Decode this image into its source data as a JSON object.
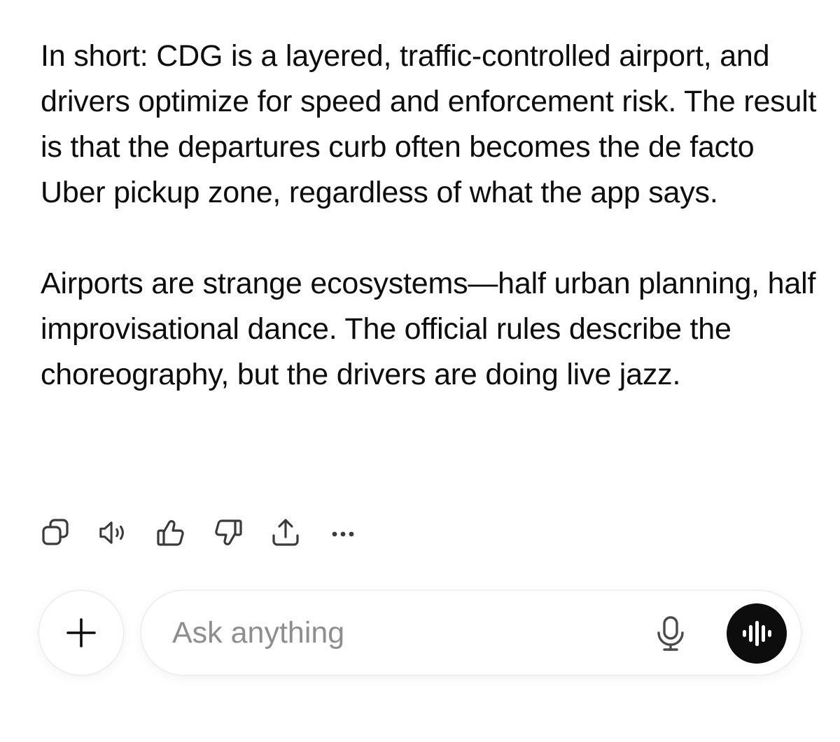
{
  "message": {
    "paragraphs": [
      "In short: CDG is a layered, traffic-controlled airport, and drivers optimize for speed and enforcement risk. The result is that the departures curb often becomes the de facto Uber pickup zone, regardless of what the app says.",
      "Airports are strange ecosystems—half urban planning, half improvisational dance. The official rules describe the choreography, but the drivers are doing live jazz."
    ]
  },
  "actions": {
    "icons": [
      "copy-icon",
      "read-aloud-icon",
      "thumbs-up-icon",
      "thumbs-down-icon",
      "share-icon",
      "more-icon"
    ]
  },
  "composer": {
    "placeholder": "Ask anything",
    "value": "",
    "plus_icon": "plus-icon",
    "mic_icon": "microphone-icon",
    "voice_icon": "voice-mode-icon"
  },
  "colors": {
    "text": "#0d0d0d",
    "placeholder": "#8e8e8e",
    "voice_button": "#0d0d0d",
    "border": "#ececec"
  }
}
